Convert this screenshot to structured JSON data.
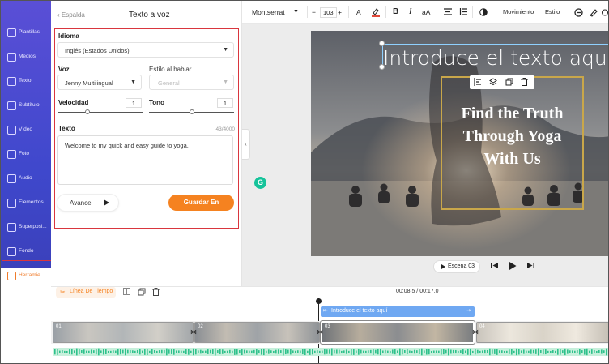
{
  "sidebar": {
    "items": [
      {
        "label": "Plantillas",
        "icon": "template-icon"
      },
      {
        "label": "Medios",
        "icon": "media-icon"
      },
      {
        "label": "Texto",
        "icon": "text-icon"
      },
      {
        "label": "Subtítulo",
        "icon": "subtitle-icon"
      },
      {
        "label": "Vídeo",
        "icon": "video-icon"
      },
      {
        "label": "Foto",
        "icon": "photo-icon"
      },
      {
        "label": "Audio",
        "icon": "audio-icon"
      },
      {
        "label": "Elementos",
        "icon": "elements-icon"
      },
      {
        "label": "Superposi...",
        "icon": "overlay-icon"
      },
      {
        "label": "Fondo",
        "icon": "background-icon"
      },
      {
        "label": "Herramie...",
        "icon": "toolbox-icon"
      }
    ]
  },
  "panel": {
    "back_label": "Espalda",
    "title": "Texto a voz",
    "language_label": "Idioma",
    "language_value": "Inglés (Estados Unidos)",
    "voice_label": "Voz",
    "voice_value": "Jenny Multilingual",
    "style_label": "Estilo al hablar",
    "style_value": "General",
    "speed_label": "Velocidad",
    "speed_value": "1",
    "speed_level": 0.35,
    "tone_label": "Tono",
    "tone_value": "1",
    "tone_level": 0.5,
    "text_label": "Texto",
    "char_count": "43/4000",
    "text_value": "Welcome to my quick and easy guide to yoga.",
    "preview_label": "Avance",
    "save_label": "Guardar En"
  },
  "toolbar": {
    "font": "Montserrat",
    "font_size": "103",
    "minus": "−",
    "plus": "+",
    "letter_a": "A",
    "bold": "B",
    "italic": "I",
    "case": "aA",
    "motion": "Movimiento",
    "style": "Estilo"
  },
  "canvas": {
    "heading_text": "Introduce el texto aquí",
    "overlay_lines": [
      "Find the Truth",
      "Through Yoga",
      "With Us"
    ],
    "scene_label": "Escena 03"
  },
  "timeline": {
    "label": "Línea De Tiempo",
    "time": "00:08.5 / 00:17.0",
    "text_clip": "Introduce el texto aquí",
    "clip_numbers": [
      "01",
      "02",
      "03",
      "04"
    ]
  },
  "colors": {
    "accent": "#f58220",
    "sidebar": "#4a4bd0",
    "clip_blue": "#6fa8f2",
    "audio": "#2fc18c",
    "highlight_box": "#d9363e"
  }
}
